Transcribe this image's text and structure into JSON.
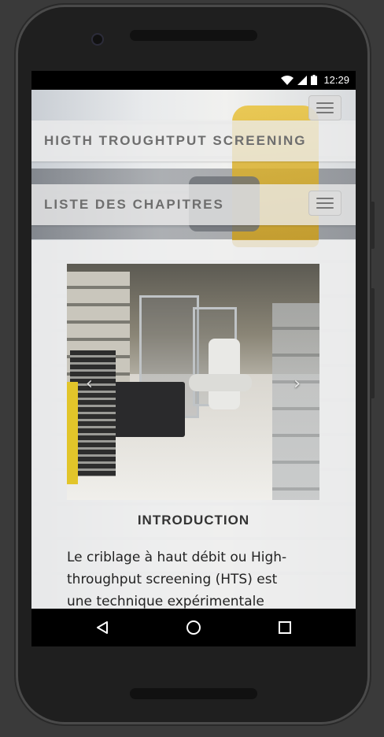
{
  "status_bar": {
    "time": "12:29"
  },
  "header": {
    "site_title": "HIGTH TROUGHTPUT SCREENING",
    "chapters_title": "LISTE DES CHAPITRES"
  },
  "carousel": {
    "prev_arrow": "‹",
    "next_arrow": "›"
  },
  "main": {
    "section_title": "INTRODUCTION",
    "intro_text": "Le criblage à haut débit ou High-throughput screening (HTS) est une technique expérimentale"
  },
  "colors": {
    "status_bar_bg": "#000000",
    "navbar_bg": "#ececec",
    "title_text": "#6e6e6e",
    "body_text": "#222222"
  },
  "icons": {
    "status": [
      "wifi-icon",
      "signal-icon",
      "battery-icon"
    ],
    "nav": [
      "back-icon",
      "home-icon",
      "recents-icon"
    ],
    "menu": "hamburger-menu-icon"
  }
}
